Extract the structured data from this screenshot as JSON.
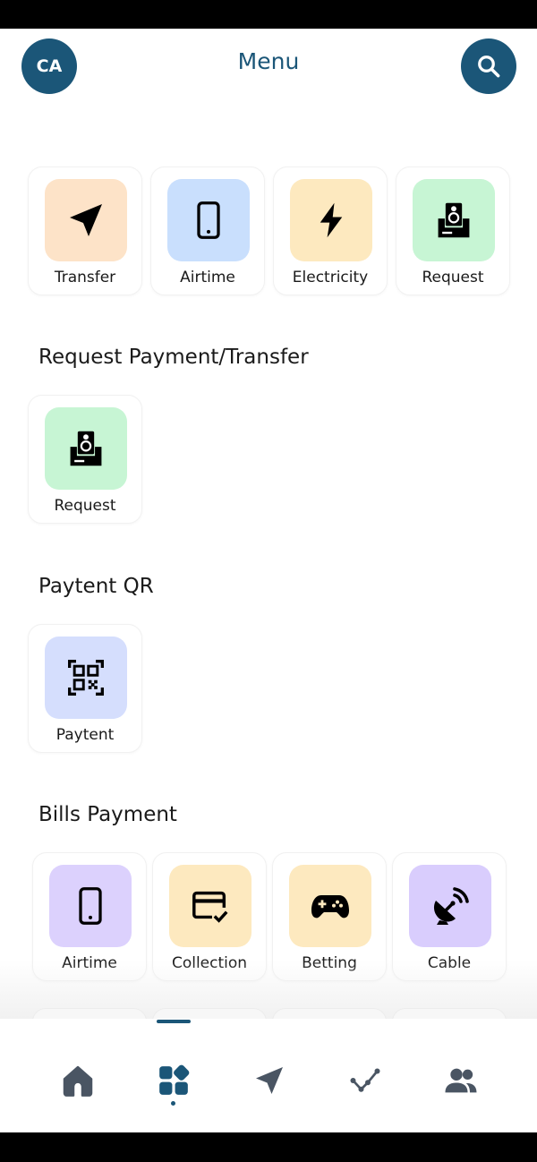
{
  "header": {
    "avatar_initials": "CA",
    "title": "Menu",
    "search_icon": "search-icon"
  },
  "quick_actions": [
    {
      "label": "Transfer",
      "icon": "send-icon",
      "bg": "#fde3c8"
    },
    {
      "label": "Airtime",
      "icon": "phone-icon",
      "bg": "#c9dffd"
    },
    {
      "label": "Electricity",
      "icon": "lightning-icon",
      "bg": "#fde9bf"
    },
    {
      "label": "Request",
      "icon": "request-icon",
      "bg": "#c7f5d4"
    }
  ],
  "sections": {
    "request": {
      "title": "Request Payment/Transfer",
      "items": [
        {
          "label": "Request",
          "icon": "request-icon",
          "bg": "#c7f5d4"
        }
      ]
    },
    "qr": {
      "title": "Paytent QR",
      "items": [
        {
          "label": "Paytent",
          "icon": "qr-code-icon",
          "bg": "#d5defd"
        }
      ]
    },
    "bills": {
      "title": "Bills Payment",
      "items": [
        {
          "label": "Airtime",
          "icon": "phone-icon",
          "bg": "#dcd1fd"
        },
        {
          "label": "Collection",
          "icon": "card-check-icon",
          "bg": "#fde9bf"
        },
        {
          "label": "Betting",
          "icon": "gamepad-icon",
          "bg": "#fde9bf"
        },
        {
          "label": "Cable",
          "icon": "satellite-dish-icon",
          "bg": "#d9cdfd"
        }
      ]
    }
  },
  "bottom_nav": [
    {
      "icon": "home-icon",
      "active": false
    },
    {
      "icon": "menu-grid-icon",
      "active": true
    },
    {
      "icon": "send-icon",
      "active": false
    },
    {
      "icon": "analytics-icon",
      "active": false
    },
    {
      "icon": "users-icon",
      "active": false
    }
  ],
  "colors": {
    "primary": "#1b5678",
    "nav_inactive": "#4a5563"
  }
}
